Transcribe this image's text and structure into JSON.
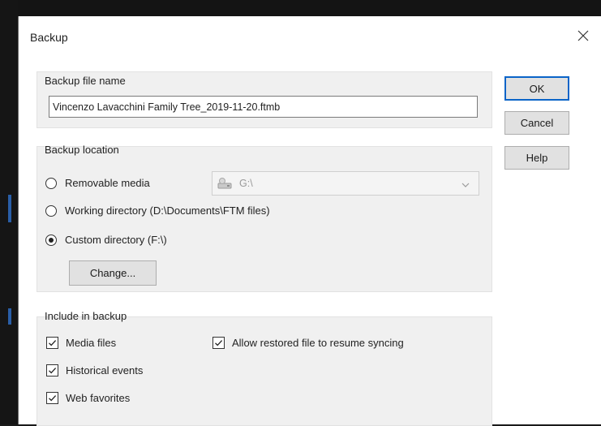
{
  "window": {
    "title": "Backup",
    "close_icon": "close-icon"
  },
  "backup_file": {
    "label": "Backup file name",
    "value": "Vincenzo Lavacchini Family Tree_2019-11-20.ftmb"
  },
  "location": {
    "label": "Backup location",
    "options": [
      {
        "label": "Removable media",
        "checked": false
      },
      {
        "label": "Working directory (D:\\Documents\\FTM files)",
        "checked": false
      },
      {
        "label": "Custom directory (F:\\)",
        "checked": true
      }
    ],
    "drive": {
      "value": "G:\\",
      "icon": "drive-icon"
    },
    "change_label": "Change..."
  },
  "include": {
    "label": "Include in backup",
    "items": [
      {
        "label": "Media files",
        "checked": true
      },
      {
        "label": "Historical events",
        "checked": true
      },
      {
        "label": "Web favorites",
        "checked": true
      },
      {
        "label": "Allow restored file to resume syncing",
        "checked": true
      }
    ]
  },
  "buttons": {
    "ok": "OK",
    "cancel": "Cancel",
    "help": "Help"
  },
  "colors": {
    "accent": "#0a64c8",
    "group_bg": "#f0f0f0",
    "button_bg": "#e1e1e1"
  }
}
